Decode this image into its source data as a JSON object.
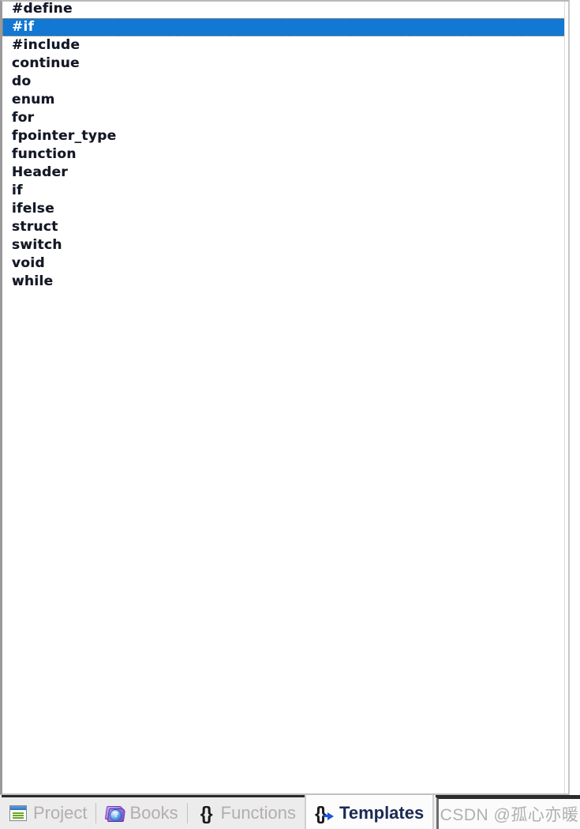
{
  "panel": {
    "name": "templates-list",
    "selected_index": 1,
    "items": [
      {
        "label": "#define"
      },
      {
        "label": "#if"
      },
      {
        "label": "#include"
      },
      {
        "label": "continue"
      },
      {
        "label": "do"
      },
      {
        "label": "enum"
      },
      {
        "label": "for"
      },
      {
        "label": "fpointer_type"
      },
      {
        "label": "function"
      },
      {
        "label": "Header"
      },
      {
        "label": "if"
      },
      {
        "label": "ifelse"
      },
      {
        "label": "struct"
      },
      {
        "label": "switch"
      },
      {
        "label": "void"
      },
      {
        "label": "while"
      }
    ]
  },
  "tabbar": {
    "tabs": [
      {
        "label": "Project",
        "icon": "project-window-icon",
        "active": false
      },
      {
        "label": "Books",
        "icon": "books-help-icon",
        "active": false
      },
      {
        "label": "Functions",
        "icon": "braces-icon",
        "active": false
      },
      {
        "label": "Templates",
        "icon": "braces-arrow-icon",
        "active": true
      }
    ]
  },
  "watermark": {
    "text": "CSDN @孤心亦暖"
  },
  "icons": {
    "books_badge_glyph": "?",
    "braces_glyph": "{}"
  },
  "colors": {
    "selection_blue": "#1278d4",
    "focus_dotted": "#d8923c",
    "tab_inactive_text": "#b4aeae",
    "tab_active_text": "#1b2a55",
    "watermark_text": "#b0b0b0",
    "list_text": "#111827"
  }
}
